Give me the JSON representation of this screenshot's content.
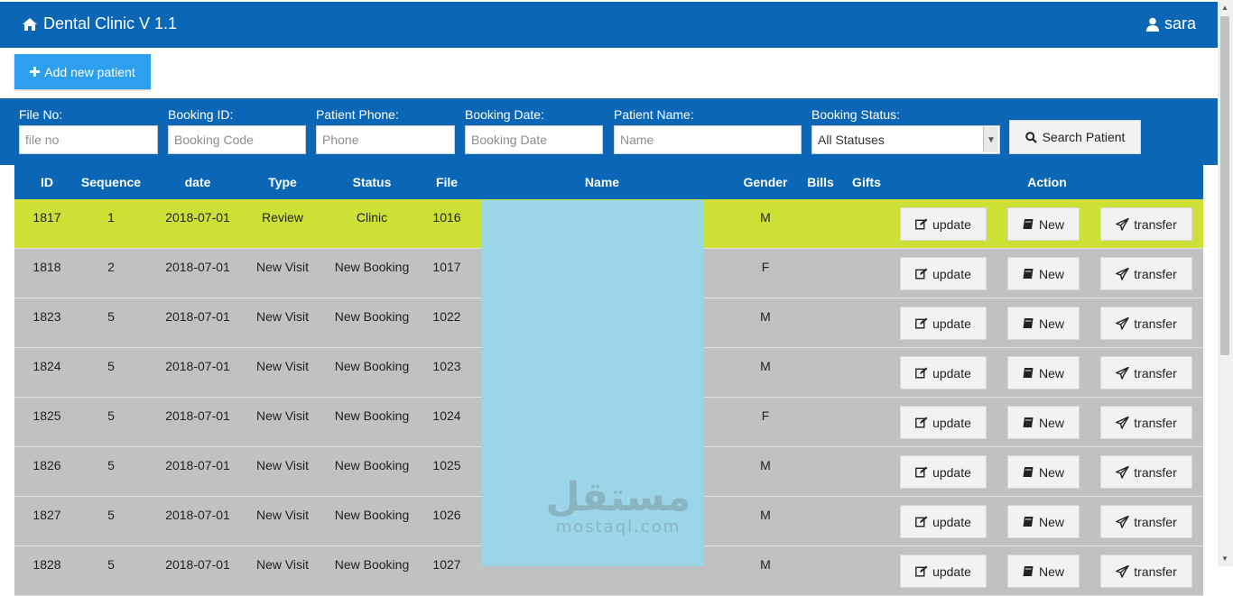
{
  "header": {
    "title": "Dental Clinic V 1.1",
    "user": "sara",
    "bg_color": "#0b67b5"
  },
  "toolbar": {
    "add_label": "Add new patient"
  },
  "filters": {
    "file_no": {
      "label": "File No:",
      "placeholder": "file no"
    },
    "booking_id": {
      "label": "Booking ID:",
      "placeholder": "Booking Code"
    },
    "phone": {
      "label": "Patient Phone:",
      "placeholder": "Phone"
    },
    "booking_date": {
      "label": "Booking Date:",
      "placeholder": "Booking Date"
    },
    "name": {
      "label": "Patient Name:",
      "placeholder": "Name"
    },
    "status": {
      "label": "Booking Status:",
      "selected": "All Statuses"
    },
    "search_label": "Search Patient"
  },
  "table": {
    "columns": [
      "ID",
      "Sequence",
      "date",
      "Type",
      "Status",
      "File",
      "Name",
      "Gender",
      "Bills",
      "Gifts",
      "Action"
    ],
    "actions": {
      "update": "update",
      "new": "New",
      "transfer": "transfer"
    },
    "rows": [
      {
        "id": "1817",
        "seq": "1",
        "date": "2018-07-01",
        "type": "Review",
        "status": "Clinic",
        "file": "1016",
        "gender": "M",
        "highlight": true
      },
      {
        "id": "1818",
        "seq": "2",
        "date": "2018-07-01",
        "type": "New Visit",
        "status": "New Booking",
        "file": "1017",
        "gender": "F"
      },
      {
        "id": "1823",
        "seq": "5",
        "date": "2018-07-01",
        "type": "New Visit",
        "status": "New Booking",
        "file": "1022",
        "gender": "M"
      },
      {
        "id": "1824",
        "seq": "5",
        "date": "2018-07-01",
        "type": "New Visit",
        "status": "New Booking",
        "file": "1023",
        "gender": "M"
      },
      {
        "id": "1825",
        "seq": "5",
        "date": "2018-07-01",
        "type": "New Visit",
        "status": "New Booking",
        "file": "1024",
        "gender": "F"
      },
      {
        "id": "1826",
        "seq": "5",
        "date": "2018-07-01",
        "type": "New Visit",
        "status": "New Booking",
        "file": "1025",
        "gender": "M"
      },
      {
        "id": "1827",
        "seq": "5",
        "date": "2018-07-01",
        "type": "New Visit",
        "status": "New Booking",
        "file": "1026",
        "gender": "M"
      },
      {
        "id": "1828",
        "seq": "5",
        "date": "2018-07-01",
        "type": "New Visit",
        "status": "New Booking",
        "file": "1027",
        "gender": "M"
      }
    ]
  },
  "colors": {
    "highlight_row": "#cde035",
    "normal_row": "#c1c1c1",
    "name_mask": "#9bd6e8",
    "add_button": "#2e9fee"
  },
  "watermark": {
    "arabic": "مستقل",
    "latin": "mostaql.com"
  }
}
